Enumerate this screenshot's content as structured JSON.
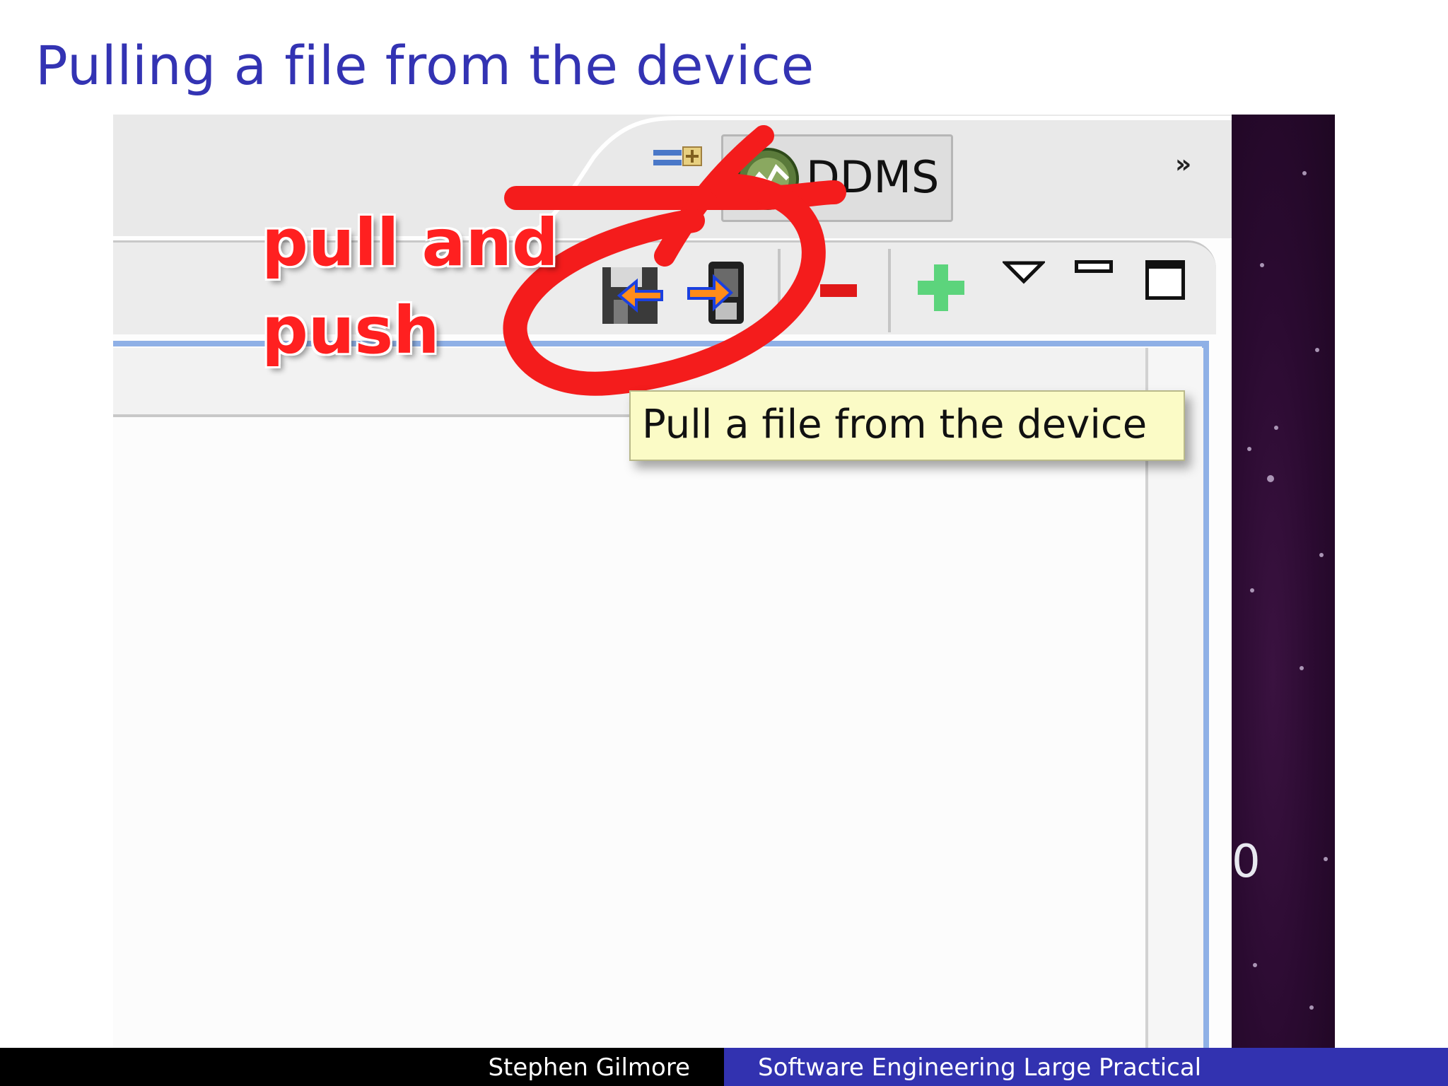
{
  "slide": {
    "title": "Pulling a file from the device"
  },
  "screenshot": {
    "perspective_tab": {
      "label": "DDMS",
      "icon": "ddms-perspective-icon"
    },
    "overflow": {
      "label": "»",
      "icon": "chevron-double-right-icon"
    },
    "annotation": {
      "line1": "pull and",
      "line2": "push",
      "color": "#ff2020"
    },
    "toolbar_icons": [
      {
        "name": "pull-file-icon"
      },
      {
        "name": "push-file-icon"
      },
      {
        "name": "delete-icon"
      },
      {
        "name": "new-folder-icon"
      },
      {
        "name": "view-menu-icon"
      },
      {
        "name": "minimize-icon"
      },
      {
        "name": "maximize-icon"
      }
    ],
    "tooltip": {
      "text": "Pull a file from the device"
    },
    "background_glyph": "0"
  },
  "footer": {
    "author": "Stephen Gilmore",
    "course": "Software Engineering Large Practical"
  },
  "colors": {
    "title": "#3333b3",
    "footer_right": "#3232b0",
    "footer_left": "#000000",
    "tooltip_bg": "#fbfbc6",
    "frame_blue": "#8fb0e6"
  }
}
